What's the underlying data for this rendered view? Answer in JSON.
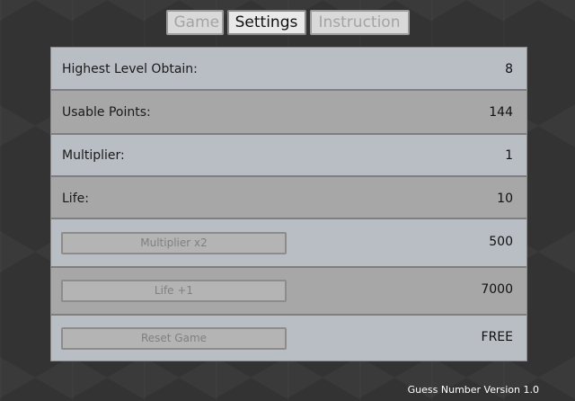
{
  "tabs": {
    "game": "Game",
    "settings": "Settings",
    "instruction": "Instruction"
  },
  "stats": {
    "highest_level_label": "Highest Level Obtain:",
    "highest_level_value": "8",
    "usable_points_label": "Usable Points:",
    "usable_points_value": "144",
    "multiplier_label": "Multiplier:",
    "multiplier_value": "1",
    "life_label": "Life:",
    "life_value": "10"
  },
  "shop": {
    "multiplier_button": "Multiplier x2",
    "multiplier_cost": "500",
    "life_button": "Life +1",
    "life_cost": "7000",
    "reset_button": "Reset Game",
    "reset_cost": "FREE"
  },
  "footer": {
    "version_text": "Guess Number Version 1.0"
  }
}
